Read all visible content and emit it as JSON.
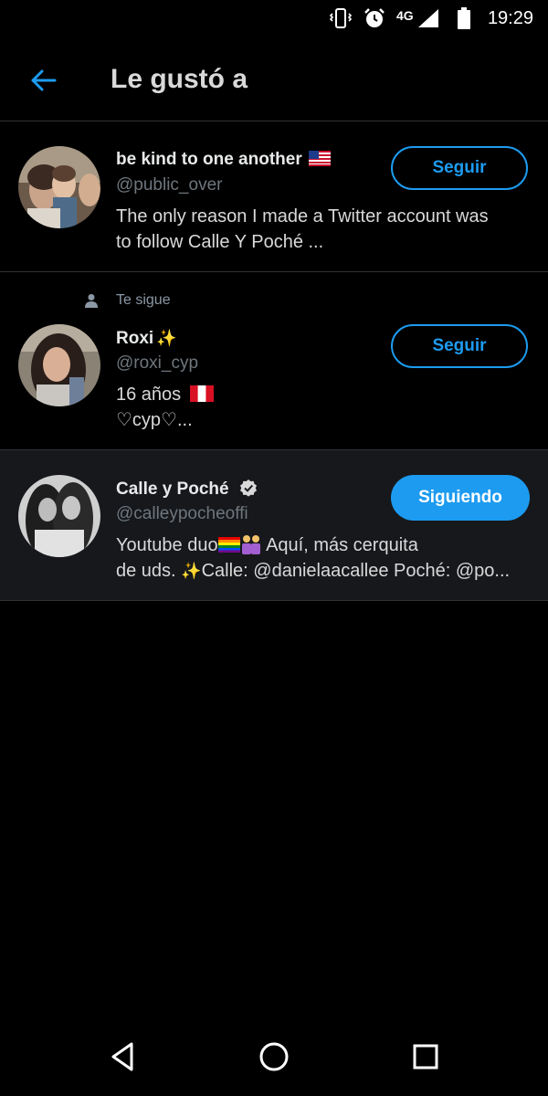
{
  "status_bar": {
    "time": "19:29",
    "network": "4G",
    "icons": [
      "vibrate-icon",
      "alarm-icon",
      "signal-icon",
      "battery-icon"
    ]
  },
  "header": {
    "title": "Le gustó a",
    "back_icon": "arrow-left-icon"
  },
  "users": [
    {
      "name": "be kind to one another",
      "name_emoji": "us-flag",
      "handle": "@public_over",
      "bio_line1": "The only reason I made a Twitter account was",
      "bio_line2": "to follow  Calle Y Poché ...",
      "button": "Seguir"
    },
    {
      "follows_you": "Te sigue",
      "name": "Roxi",
      "name_emoji": "✨",
      "handle": "@roxi_cyp",
      "bio_line1": "16 años",
      "bio_line1_emoji": "peru-flag",
      "bio_line2": "♡cyp♡...",
      "button": "Seguir"
    },
    {
      "name": "Calle y Poché",
      "verified": true,
      "handle": "@calleypocheoffi",
      "bio_line1_a": "Youtube duo",
      "bio_line1_b": " Aquí, más cerquita",
      "bio_line2_a": "de uds. ",
      "bio_line2_b": "Calle: @danielaacallee Poché: @po...",
      "bio_sparkle": "✨",
      "button": "Siguiendo"
    }
  ],
  "nav": {
    "back": "back-triangle-icon",
    "home": "home-circle-icon",
    "recents": "recents-square-icon"
  },
  "colors": {
    "accent": "#1d9bf0",
    "background": "#000000",
    "highlight_row": "#16181c",
    "secondary_text": "#6e767d"
  }
}
